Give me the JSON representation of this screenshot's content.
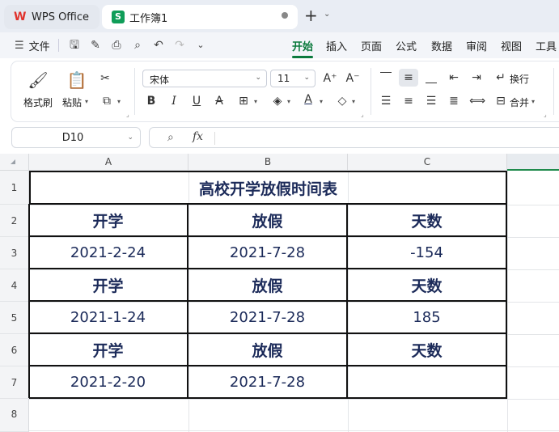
{
  "titlebar": {
    "home_tab": "WPS Office",
    "doc_tab": "工作簿1"
  },
  "menubar": {
    "file": "文件",
    "tabs": [
      "开始",
      "插入",
      "页面",
      "公式",
      "数据",
      "审阅",
      "视图",
      "工具"
    ],
    "active_tab": "开始"
  },
  "ribbon": {
    "format_painter": "格式刷",
    "paste": "粘贴",
    "font_name": "宋体",
    "font_size": "11",
    "wrap_text": "换行",
    "merge": "合并"
  },
  "formula_bar": {
    "name_box": "D10",
    "fx": "fx",
    "content": ""
  },
  "sheet": {
    "columns": [
      "A",
      "B",
      "C"
    ],
    "rows": [
      "1",
      "2",
      "3",
      "4",
      "5",
      "6",
      "7",
      "8"
    ],
    "title": "高校开学放假时间表",
    "table": [
      [
        "开学",
        "放假",
        "天数"
      ],
      [
        "2021-2-24",
        "2021-7-28",
        "-154"
      ],
      [
        "开学",
        "放假",
        "天数"
      ],
      [
        "2021-1-24",
        "2021-7-28",
        "185"
      ],
      [
        "开学",
        "放假",
        "天数"
      ],
      [
        "2021-2-20",
        "2021-7-28",
        ""
      ]
    ]
  },
  "colors": {
    "accent": "#0b7a3d",
    "cell_text": "#1b2a59",
    "border": "#111111"
  }
}
